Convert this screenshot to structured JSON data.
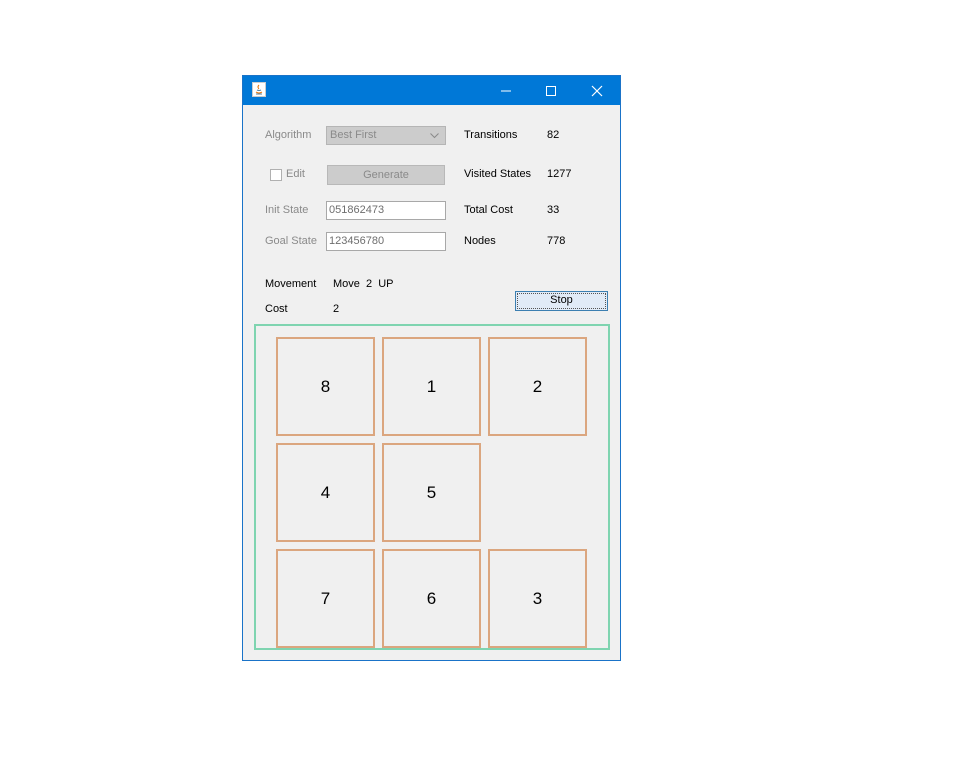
{
  "window": {
    "title": ""
  },
  "controls": {
    "algorithm_label": "Algorithm",
    "algorithm_value": "Best First",
    "edit_label": "Edit",
    "generate_label": "Generate",
    "init_state_label": "Init State",
    "init_state_value": "051862473",
    "goal_state_label": "Goal State",
    "goal_state_value": "123456780",
    "stop_label": "Stop"
  },
  "stats": {
    "transitions_label": "Transitions",
    "transitions_value": "82",
    "visited_states_label": "Visited States",
    "visited_states_value": "1277",
    "total_cost_label": "Total Cost",
    "total_cost_value": "33",
    "nodes_label": "Nodes",
    "nodes_value": "778"
  },
  "movement": {
    "movement_label": "Movement",
    "movement_value": "Move  2  UP",
    "cost_label": "Cost",
    "cost_value": "2"
  },
  "board": {
    "rows": [
      [
        "8",
        "1",
        "2"
      ],
      [
        "4",
        "5",
        ""
      ],
      [
        "7",
        "6",
        "3"
      ]
    ]
  },
  "colors": {
    "titlebar": "#0078d7",
    "board_border": "#7fd4b0",
    "tile_border": "#dba67f"
  }
}
